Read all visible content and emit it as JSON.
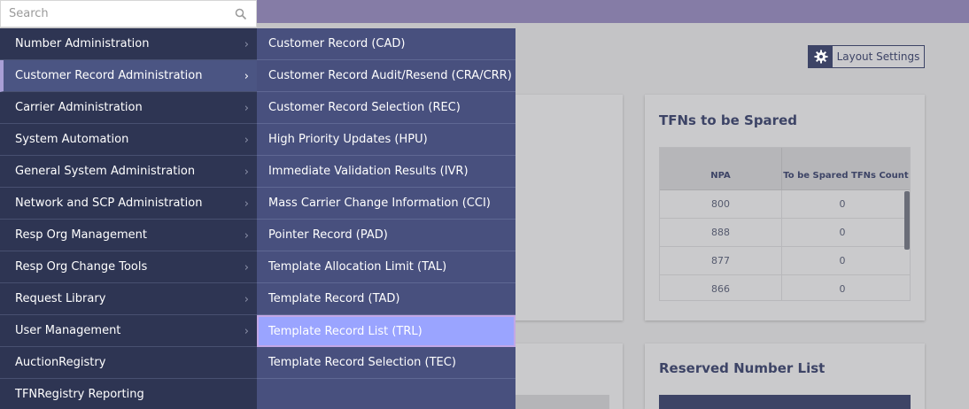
{
  "search": {
    "placeholder": "Search",
    "icon": "search-icon"
  },
  "layout_settings": {
    "label": "Layout Settings",
    "icon": "gear-icon"
  },
  "cards": {
    "tfn_spared": {
      "title": "TFNs to be Spared",
      "columns": [
        "NPA",
        "To be Spared TFNs Count"
      ],
      "rows": [
        {
          "npa": "800",
          "count": "0"
        },
        {
          "npa": "888",
          "count": "0"
        },
        {
          "npa": "877",
          "count": "0"
        },
        {
          "npa": "866",
          "count": "0"
        }
      ]
    },
    "reserved": {
      "title": "Reserved Number List"
    }
  },
  "menu": {
    "items": [
      {
        "label": "Number Administration",
        "has_submenu": true
      },
      {
        "label": "Customer Record Administration",
        "has_submenu": true,
        "active": true
      },
      {
        "label": "Carrier Administration",
        "has_submenu": true
      },
      {
        "label": "System Automation",
        "has_submenu": true
      },
      {
        "label": "General System Administration",
        "has_submenu": true
      },
      {
        "label": "Network and SCP Administration",
        "has_submenu": true
      },
      {
        "label": "Resp Org Management",
        "has_submenu": true
      },
      {
        "label": "Resp Org Change Tools",
        "has_submenu": true
      },
      {
        "label": "Request Library",
        "has_submenu": true
      },
      {
        "label": "User Management",
        "has_submenu": true
      },
      {
        "label": "AuctionRegistry",
        "has_submenu": false
      },
      {
        "label": "TFNRegistry Reporting",
        "has_submenu": false
      }
    ]
  },
  "submenu": {
    "items": [
      {
        "label": "Customer Record (CAD)"
      },
      {
        "label": "Customer Record Audit/Resend (CRA/CRR)"
      },
      {
        "label": "Customer Record Selection (REC)"
      },
      {
        "label": "High Priority Updates (HPU)"
      },
      {
        "label": "Immediate Validation Results (IVR)"
      },
      {
        "label": "Mass Carrier Change Information (CCI)"
      },
      {
        "label": "Pointer Record (PAD)"
      },
      {
        "label": "Template Allocation Limit (TAL)"
      },
      {
        "label": "Template Record (TAD)"
      },
      {
        "label": "Template Record List (TRL)",
        "hover": true
      },
      {
        "label": "Template Record Selection (TEC)"
      }
    ]
  },
  "colors": {
    "sidebar": "#2e3553",
    "submenu": "#48507e",
    "highlight": "#9aa4ff",
    "topbar": "#857ca6"
  }
}
